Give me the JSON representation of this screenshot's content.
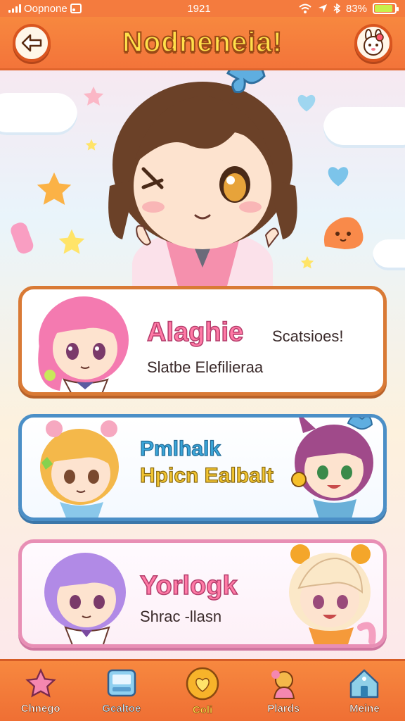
{
  "status_bar": {
    "carrier": "Oopnone",
    "time": "1921",
    "battery": "83%",
    "battery_level": 0.83
  },
  "header": {
    "title": "Nodneneia!",
    "back_icon": "back-arrow-icon",
    "profile_icon": "bunny-avatar-icon"
  },
  "cards": [
    {
      "name": "Alaghie",
      "subtitle": "Slatbe Elefilieraa",
      "side_text": "Scatsioes!",
      "accent": "#d97a35"
    },
    {
      "name_line1": "Pmlhalk",
      "name_line2": "Hpicn Ealbalt",
      "accent": "#4b8fc7"
    },
    {
      "name": "Yorlogk",
      "subtitle": "Shrac -llasn",
      "accent": "#e88fb5"
    }
  ],
  "nav": [
    {
      "label": "Chnego",
      "icon": "star-icon"
    },
    {
      "label": "Gcaltoe",
      "icon": "screen-icon"
    },
    {
      "label": "Coli",
      "icon": "heart-icon"
    },
    {
      "label": "Plards",
      "icon": "character-icon"
    },
    {
      "label": "Meine",
      "icon": "house-icon"
    }
  ],
  "colors": {
    "header": "#f47b3e",
    "title": "#ffe04a",
    "pink_name": "#ff7aa6",
    "blue_name": "#3ba6d9",
    "yellow_name": "#f2c531"
  }
}
